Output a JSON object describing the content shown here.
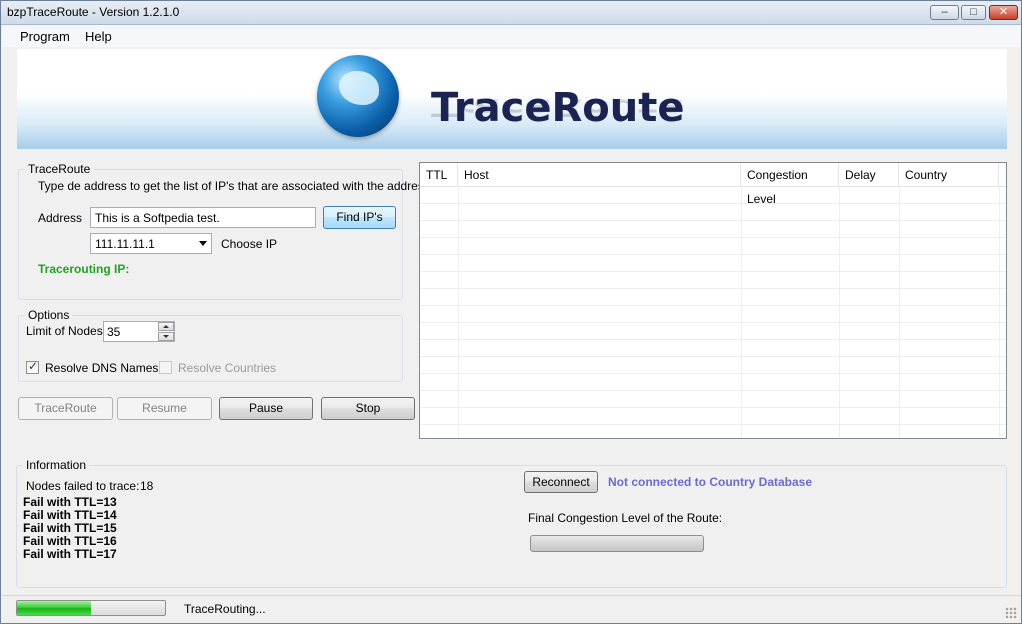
{
  "window": {
    "title": "bzpTraceRoute - Version 1.2.1.0",
    "minimize_glyph": "–",
    "maximize_glyph": "□",
    "close_glyph": "✕"
  },
  "menu": {
    "program": "Program",
    "help": "Help"
  },
  "banner": {
    "title": "TraceRoute",
    "icon": "globe-icon"
  },
  "traceroute_group": {
    "legend": "TraceRoute",
    "description": "Type de address to get the list of IP's that are associated with the address",
    "address_label": "Address",
    "address_value": "This is a Softpedia test.",
    "find_button": "Find IP's",
    "ip_selected": "111.11.11.1",
    "choose_ip_label": "Choose IP",
    "tracerouting_label": "Tracerouting IP:"
  },
  "options_group": {
    "legend": "Options",
    "limit_label": "Limit of Nodes",
    "limit_value": "35",
    "resolve_dns_label": "Resolve DNS Names",
    "resolve_dns_checked": true,
    "resolve_countries_label": "Resolve Countries",
    "resolve_countries_checked": false
  },
  "actions": {
    "traceroute": "TraceRoute",
    "resume": "Resume",
    "pause": "Pause",
    "stop": "Stop"
  },
  "results_table": {
    "columns": [
      "TTL",
      "Host",
      "Congestion Level",
      "Delay",
      "Country"
    ],
    "rows": []
  },
  "information_group": {
    "legend": "Information",
    "nodes_failed_label": "Nodes failed to trace:",
    "nodes_failed_count": "18",
    "failures": [
      "Fail with TTL=13",
      "Fail with TTL=14",
      "Fail with TTL=15",
      "Fail with TTL=16",
      "Fail with TTL=17"
    ],
    "reconnect_button": "Reconnect",
    "db_status": "Not connected to Country Database",
    "final_congestion_label": "Final Congestion Level of the Route:",
    "final_congestion_level": 0
  },
  "status_bar": {
    "progress_percent": 50,
    "status_text": "TraceRouting..."
  },
  "colors": {
    "tracerouting": "#22a222",
    "db_status": "#6b6bcf",
    "progress": "#17b417"
  }
}
